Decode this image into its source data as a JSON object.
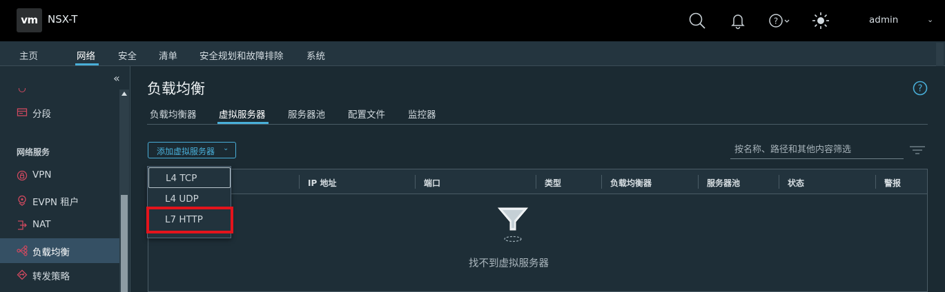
{
  "header": {
    "logo_text": "vm",
    "app_title": "NSX-T",
    "user": "admin",
    "icons": [
      "search-icon",
      "bell-icon",
      "help-icon",
      "theme-sun-icon"
    ]
  },
  "main_nav": {
    "items": [
      {
        "label": "主页",
        "active": false
      },
      {
        "label": "网络",
        "active": true
      },
      {
        "label": "安全",
        "active": false
      },
      {
        "label": "清单",
        "active": false
      },
      {
        "label": "安全规划和故障排除",
        "active": false
      },
      {
        "label": "系统",
        "active": false
      }
    ]
  },
  "sidebar": {
    "collapse_glyph": "«",
    "segments_label": "分段",
    "section_title": "网络服务",
    "items": [
      {
        "label": "VPN",
        "icon": "vpn-icon",
        "active": false
      },
      {
        "label": "EVPN 租户",
        "icon": "evpn-icon",
        "active": false
      },
      {
        "label": "NAT",
        "icon": "nat-icon",
        "active": false
      },
      {
        "label": "负载均衡",
        "icon": "load-balancer-icon",
        "active": true
      },
      {
        "label": "转发策略",
        "icon": "forwarding-policy-icon",
        "active": false
      }
    ]
  },
  "page": {
    "title": "负载均衡",
    "tabs": [
      {
        "label": "负载均衡器",
        "active": false
      },
      {
        "label": "虚拟服务器",
        "active": true
      },
      {
        "label": "服务器池",
        "active": false
      },
      {
        "label": "配置文件",
        "active": false
      },
      {
        "label": "监控器",
        "active": false
      }
    ],
    "add_button_label": "添加虚拟服务器",
    "add_button_caret": "⌄",
    "filter_placeholder": "按名称、路径和其他内容筛选"
  },
  "grid": {
    "columns": [
      "IP 地址",
      "端口",
      "类型",
      "负载均衡器",
      "服务器池",
      "状态",
      "警报"
    ],
    "empty_text": "找不到虚拟服务器"
  },
  "dropdown": {
    "items": [
      {
        "label": "L4 TCP",
        "focused": true
      },
      {
        "label": "L4 UDP",
        "focused": false
      },
      {
        "label": "L7 HTTP",
        "focused": false,
        "highlighted": true
      }
    ]
  },
  "colors": {
    "accent": "#49afd9",
    "highlight": "#e4141c",
    "topbar": "#000000",
    "background": "#1b2a32"
  }
}
